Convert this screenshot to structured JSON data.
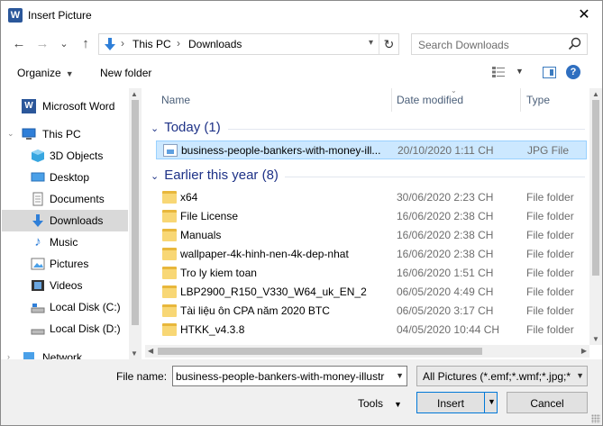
{
  "window": {
    "title": "Insert Picture",
    "app_icon": "W",
    "close": "✕"
  },
  "nav": {
    "back": "←",
    "forward": "→",
    "recent": "⌄",
    "up": "↑",
    "breadcrumb": [
      "This PC",
      "Downloads"
    ],
    "separator": "›",
    "search_placeholder": "Search Downloads"
  },
  "toolbar": {
    "organize": "Organize",
    "new_folder": "New folder"
  },
  "sidebar": {
    "items": [
      {
        "label": "Microsoft Word",
        "icon": "word-icon"
      },
      {
        "label": "This PC",
        "icon": "pc-icon"
      },
      {
        "label": "3D Objects",
        "icon": "3d-objects-icon"
      },
      {
        "label": "Desktop",
        "icon": "desktop-icon"
      },
      {
        "label": "Documents",
        "icon": "documents-icon"
      },
      {
        "label": "Downloads",
        "icon": "downloads-icon",
        "selected": true
      },
      {
        "label": "Music",
        "icon": "music-icon"
      },
      {
        "label": "Pictures",
        "icon": "pictures-icon"
      },
      {
        "label": "Videos",
        "icon": "videos-icon"
      },
      {
        "label": "Local Disk (C:)",
        "icon": "drive-icon"
      },
      {
        "label": "Local Disk (D:)",
        "icon": "drive-icon"
      },
      {
        "label": "Network",
        "icon": "network-icon"
      }
    ]
  },
  "columns": {
    "name": "Name",
    "date": "Date modified",
    "type": "Type"
  },
  "groups": [
    {
      "label": "Today (1)",
      "files": [
        {
          "name": "business-people-bankers-with-money-ill...",
          "date": "20/10/2020 1:11 CH",
          "type": "JPG File",
          "icon": "jpg-file-icon",
          "selected": true
        }
      ]
    },
    {
      "label": "Earlier this year (8)",
      "files": [
        {
          "name": "x64",
          "date": "30/06/2020 2:23 CH",
          "type": "File folder",
          "icon": "folder-icon"
        },
        {
          "name": "File License",
          "date": "16/06/2020 2:38 CH",
          "type": "File folder",
          "icon": "folder-icon"
        },
        {
          "name": "Manuals",
          "date": "16/06/2020 2:38 CH",
          "type": "File folder",
          "icon": "folder-icon"
        },
        {
          "name": "wallpaper-4k-hinh-nen-4k-dep-nhat",
          "date": "16/06/2020 2:38 CH",
          "type": "File folder",
          "icon": "folder-icon"
        },
        {
          "name": "Tro ly kiem toan",
          "date": "16/06/2020 1:51 CH",
          "type": "File folder",
          "icon": "folder-icon"
        },
        {
          "name": "LBP2900_R150_V330_W64_uk_EN_2",
          "date": "06/05/2020 4:49 CH",
          "type": "File folder",
          "icon": "folder-icon"
        },
        {
          "name": "Tài liệu ôn CPA năm 2020 BTC",
          "date": "06/05/2020 3:17 CH",
          "type": "File folder",
          "icon": "folder-icon"
        },
        {
          "name": "HTKK_v4.3.8",
          "date": "04/05/2020 10:44 CH",
          "type": "File folder",
          "icon": "folder-icon"
        }
      ]
    }
  ],
  "footer": {
    "file_name_label": "File name:",
    "file_name_value": "business-people-bankers-with-money-illustr",
    "filter_value": "All Pictures (*.emf;*.wmf;*.jpg;*",
    "tools": "Tools",
    "insert": "Insert",
    "cancel": "Cancel"
  },
  "colors": {
    "accent": "#0078d7",
    "group_header": "#1e3287",
    "selection": "#cce8ff",
    "sidebar_selection": "#d9d9d9"
  }
}
